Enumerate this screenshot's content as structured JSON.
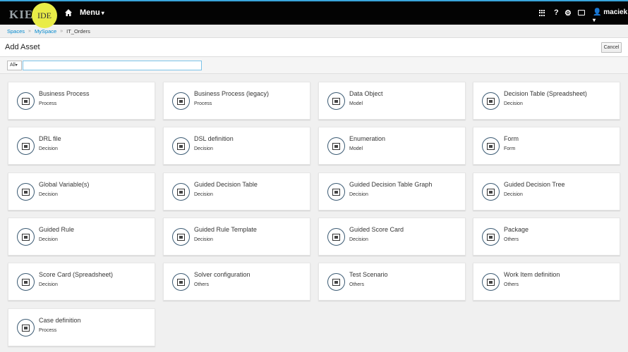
{
  "header": {
    "logo_kie": "KIE",
    "logo_ide": "IDE",
    "menu_label": "Menu",
    "help_label": "?",
    "user_label": "maciek"
  },
  "breadcrumb": [
    "Spaces",
    "MySpace",
    "IT_Orders"
  ],
  "page": {
    "title": "Add Asset",
    "cancel_label": "Cancel"
  },
  "filter": {
    "selected": "All",
    "search_value": ""
  },
  "assets": [
    {
      "title": "Business Process",
      "category": "Process",
      "icon": "process-icon"
    },
    {
      "title": "Business Process (legacy)",
      "category": "Process",
      "icon": "process-icon"
    },
    {
      "title": "Data Object",
      "category": "Model",
      "icon": "data-object-icon"
    },
    {
      "title": "Decision Table (Spreadsheet)",
      "category": "Decision",
      "icon": "spreadsheet-icon"
    },
    {
      "title": "DRL file",
      "category": "Decision",
      "icon": "drl-file-icon"
    },
    {
      "title": "DSL definition",
      "category": "Decision",
      "icon": "dsl-icon"
    },
    {
      "title": "Enumeration",
      "category": "Model",
      "icon": "enumeration-icon"
    },
    {
      "title": "Form",
      "category": "Form",
      "icon": "form-icon"
    },
    {
      "title": "Global Variable(s)",
      "category": "Decision",
      "icon": "global-variable-icon"
    },
    {
      "title": "Guided Decision Table",
      "category": "Decision",
      "icon": "guided-table-icon"
    },
    {
      "title": "Guided Decision Table Graph",
      "category": "Decision",
      "icon": "guided-table-graph-icon"
    },
    {
      "title": "Guided Decision Tree",
      "category": "Decision",
      "icon": "guided-tree-icon"
    },
    {
      "title": "Guided Rule",
      "category": "Decision",
      "icon": "guided-rule-icon"
    },
    {
      "title": "Guided Rule Template",
      "category": "Decision",
      "icon": "guided-rule-template-icon"
    },
    {
      "title": "Guided Score Card",
      "category": "Decision",
      "icon": "score-card-icon"
    },
    {
      "title": "Package",
      "category": "Others",
      "icon": "package-icon"
    },
    {
      "title": "Score Card (Spreadsheet)",
      "category": "Decision",
      "icon": "score-card-spreadsheet-icon"
    },
    {
      "title": "Solver configuration",
      "category": "Others",
      "icon": "solver-icon"
    },
    {
      "title": "Test Scenario",
      "category": "Others",
      "icon": "test-scenario-icon"
    },
    {
      "title": "Work Item definition",
      "category": "Others",
      "icon": "work-item-icon"
    },
    {
      "title": "Case definition",
      "category": "Process",
      "icon": "process-icon"
    }
  ],
  "colors": {
    "topbar": "#030303",
    "accent": "#39a5dc",
    "link": "#0088ce",
    "logo_badge": "#e9ec47"
  }
}
